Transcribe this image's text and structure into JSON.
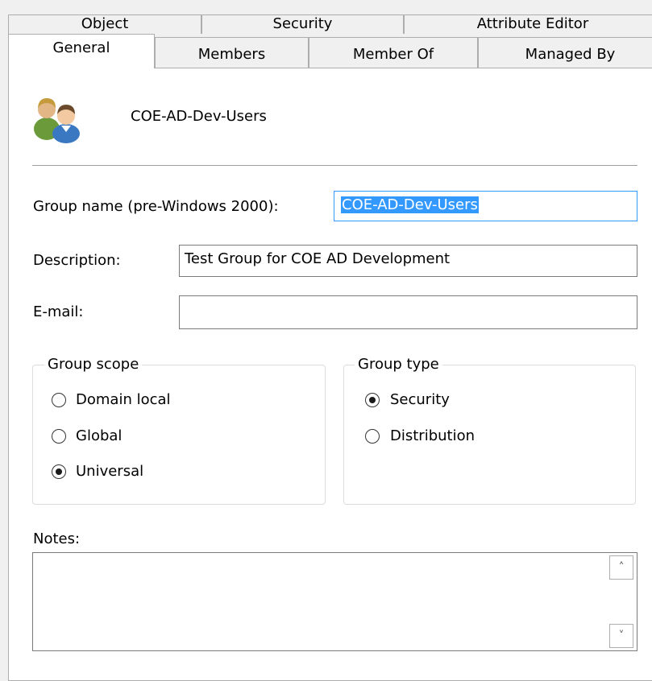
{
  "tabs_back": [
    "Object",
    "Security",
    "Attribute Editor"
  ],
  "tabs_front": [
    "General",
    "Members",
    "Member Of",
    "Managed By"
  ],
  "group_display_name": "COE-AD-Dev-Users",
  "fields": {
    "group_name_label": "Group name (pre-Windows 2000):",
    "group_name_value": "COE-AD-Dev-Users",
    "description_label": "Description:",
    "description_value": "Test Group for COE AD Development",
    "email_label": "E-mail:",
    "email_value": ""
  },
  "group_scope": {
    "title": "Group scope",
    "options": [
      "Domain local",
      "Global",
      "Universal"
    ],
    "selected": "Universal"
  },
  "group_type": {
    "title": "Group type",
    "options": [
      "Security",
      "Distribution"
    ],
    "selected": "Security"
  },
  "notes": {
    "label": "Notes:",
    "value": ""
  },
  "icons": {
    "group": "group-users-icon",
    "scroll_up": "scroll-up-arrow-icon",
    "scroll_down": "scroll-down-arrow-icon"
  },
  "colors": {
    "selection": "#3399ff",
    "field_border": "#7a7a7a",
    "panel_bg": "#ffffff",
    "window_bg": "#f0f0f0"
  }
}
